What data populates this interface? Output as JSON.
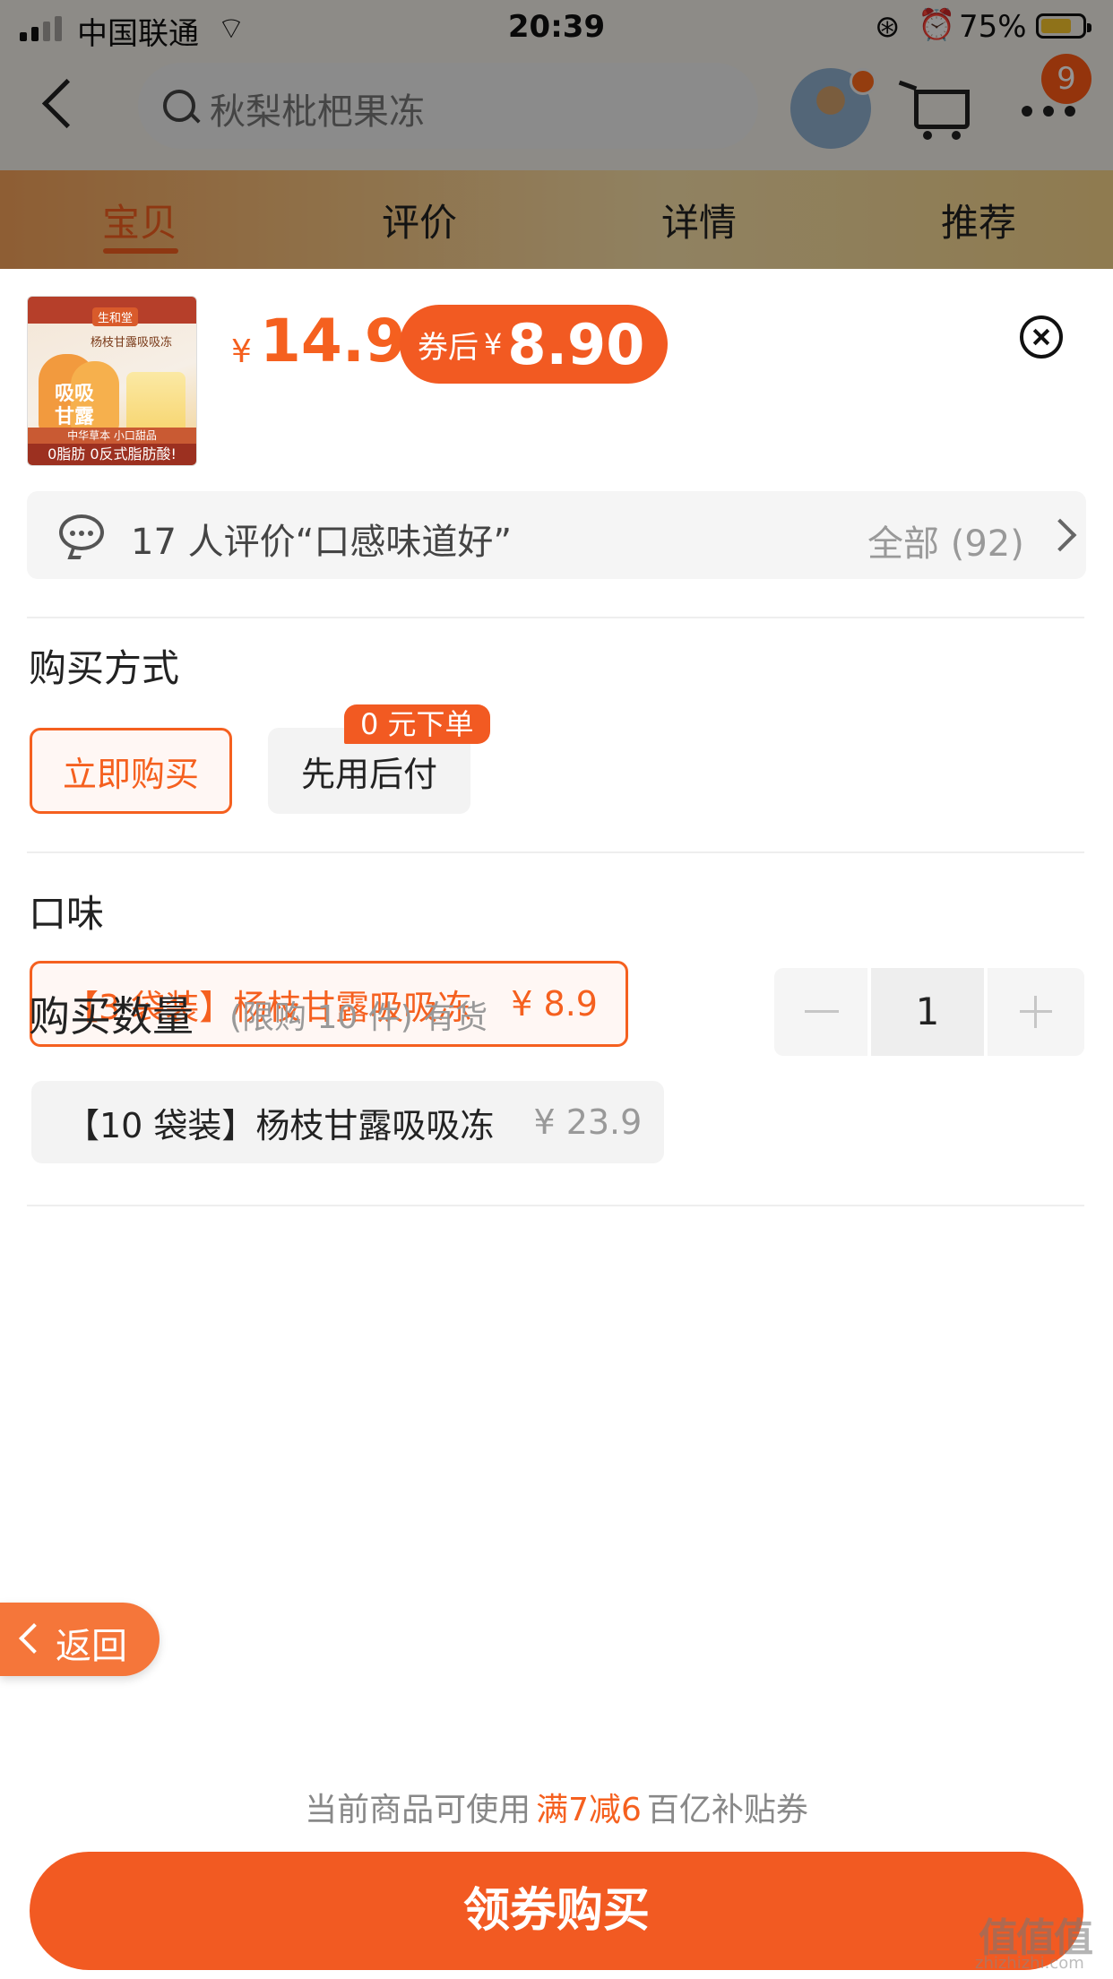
{
  "status_bar": {
    "carrier": "中国联通",
    "time": "20:39",
    "battery": "75%",
    "battery_level": 0.75
  },
  "header": {
    "search_placeholder": "秋梨枇杷果冻",
    "cart_badge": "9"
  },
  "tabs": [
    {
      "label": "宝贝",
      "active": true
    },
    {
      "label": "评价",
      "active": false
    },
    {
      "label": "详情",
      "active": false
    },
    {
      "label": "推荐",
      "active": false
    }
  ],
  "product": {
    "thumbnail": {
      "brand": "生和堂",
      "subtitle": "杨枝甘露吸吸冻",
      "big_text": "吸吸甘露",
      "line1": "中华草本 小口甜品",
      "line2": "0脂肪 0反式脂肪酸!"
    },
    "price_symbol": "¥",
    "price": "14.9",
    "coupon_label": "券后",
    "coupon_symbol": "¥",
    "coupon_price": "8.90"
  },
  "reviews": {
    "summary": "17 人评价“口感味道好”",
    "all_label": "全部 (92)"
  },
  "purchase_method": {
    "title": "购买方式",
    "options": [
      {
        "label": "立即购买",
        "selected": true
      },
      {
        "label": "先用后付",
        "selected": false
      }
    ],
    "tag": "0 元下单"
  },
  "flavor": {
    "title": "口味",
    "options": [
      {
        "label": "【3 袋装】杨枝甘露吸吸冻",
        "price": "¥ 8.9",
        "selected": true
      },
      {
        "label": "【10 袋装】杨枝甘露吸吸冻",
        "price": "¥ 23.9",
        "selected": false
      }
    ]
  },
  "quantity": {
    "title": "购买数量",
    "note": "(限购 10 件) 有货",
    "value": "1"
  },
  "floating": {
    "back_label": "返回"
  },
  "footer": {
    "hint_prefix": "当前商品可使用",
    "hint_highlight": "满7减6",
    "hint_suffix": "百亿补贴券",
    "buy_button": "领券购买"
  },
  "watermark": {
    "main": "值值值",
    "sub": "zhizhizhi.com"
  },
  "colors": {
    "accent": "#f5601f",
    "button": "#f25a22"
  }
}
